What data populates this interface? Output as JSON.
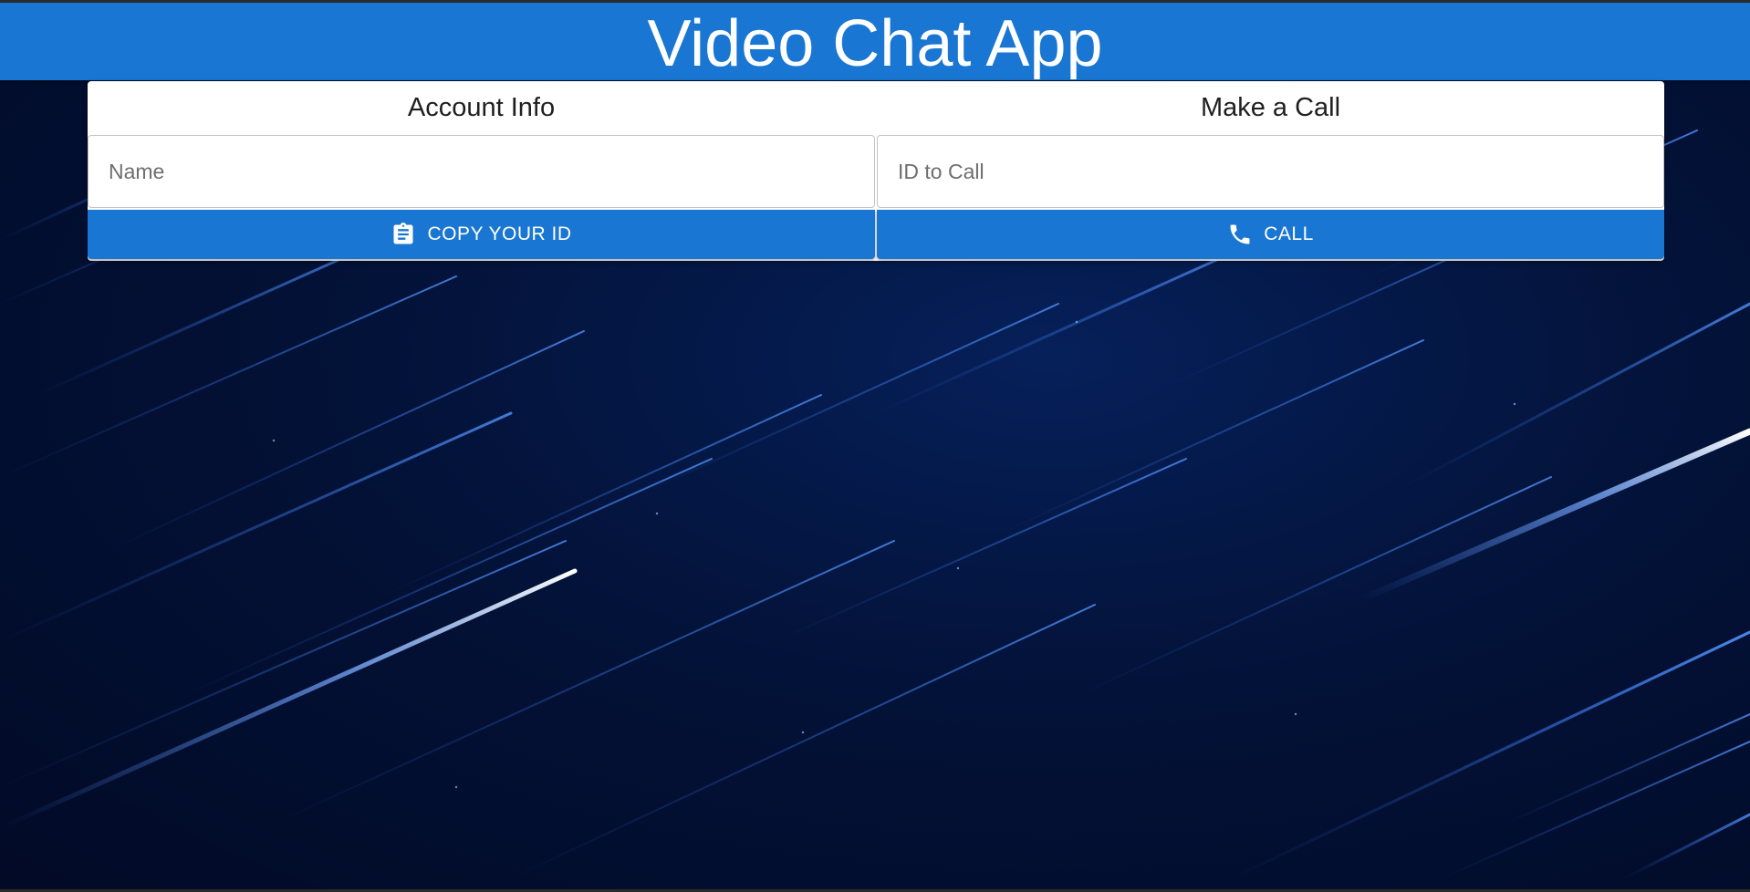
{
  "app": {
    "title": "Video Chat App"
  },
  "account": {
    "heading": "Account Info",
    "name_placeholder": "Name",
    "name_value": "",
    "copy_button_label": "COPY YOUR ID",
    "copy_icon": "clipboard-icon"
  },
  "call": {
    "heading": "Make a Call",
    "id_placeholder": "ID to Call",
    "id_value": "",
    "call_button_label": "CALL",
    "call_icon": "phone-icon"
  },
  "colors": {
    "primary": "#1976d2",
    "background": "#031238"
  }
}
